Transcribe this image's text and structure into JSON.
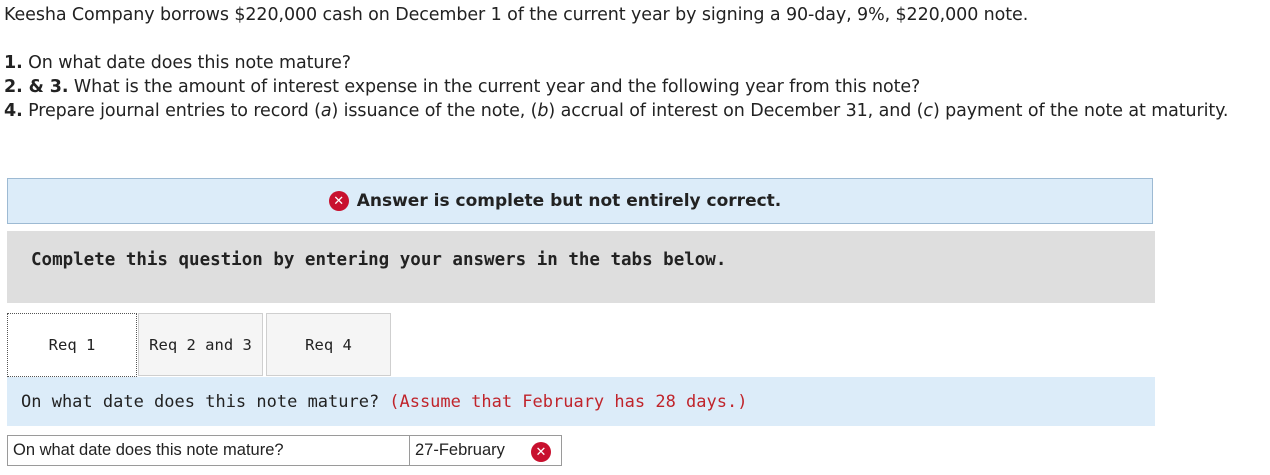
{
  "question": {
    "intro": "Keesha Company borrows $220,000 cash on December 1 of the current year by signing a 90-day, 9%, $220,000 note.",
    "q1_num": "1.",
    "q1_text": " On what date does this note mature?",
    "q23_num": "2. & 3.",
    "q23_text": " What is the amount of interest expense in the current year and the following year from this note?",
    "q4_num": "4.",
    "q4_part1": " Prepare journal entries to record (",
    "q4_a": "a",
    "q4_part2": ") issuance of the note, (",
    "q4_b": "b",
    "q4_part3": ") accrual of interest on December 31, and (",
    "q4_c": "c",
    "q4_part4": ") payment of the note at maturity."
  },
  "feedback": {
    "status_icon": "x-icon",
    "status_text": "Answer is complete but not entirely correct."
  },
  "instruction": "Complete this question by entering your answers in the tabs below.",
  "tabs": [
    {
      "label": "Req 1",
      "active": true
    },
    {
      "label": "Req 2 and 3",
      "active": false
    },
    {
      "label": "Req 4",
      "active": false
    }
  ],
  "req1": {
    "question": "On what date does this note mature?",
    "hint": "(Assume that February has 28 days.)",
    "row_label": "On what date does this note mature?",
    "answer_value": "27-February",
    "answer_status_icon": "x-icon"
  },
  "colors": {
    "incorrect": "#c8102e",
    "hint": "#c0242b",
    "banner_bg": "#dcecf9",
    "instruction_bg": "#dedede"
  }
}
